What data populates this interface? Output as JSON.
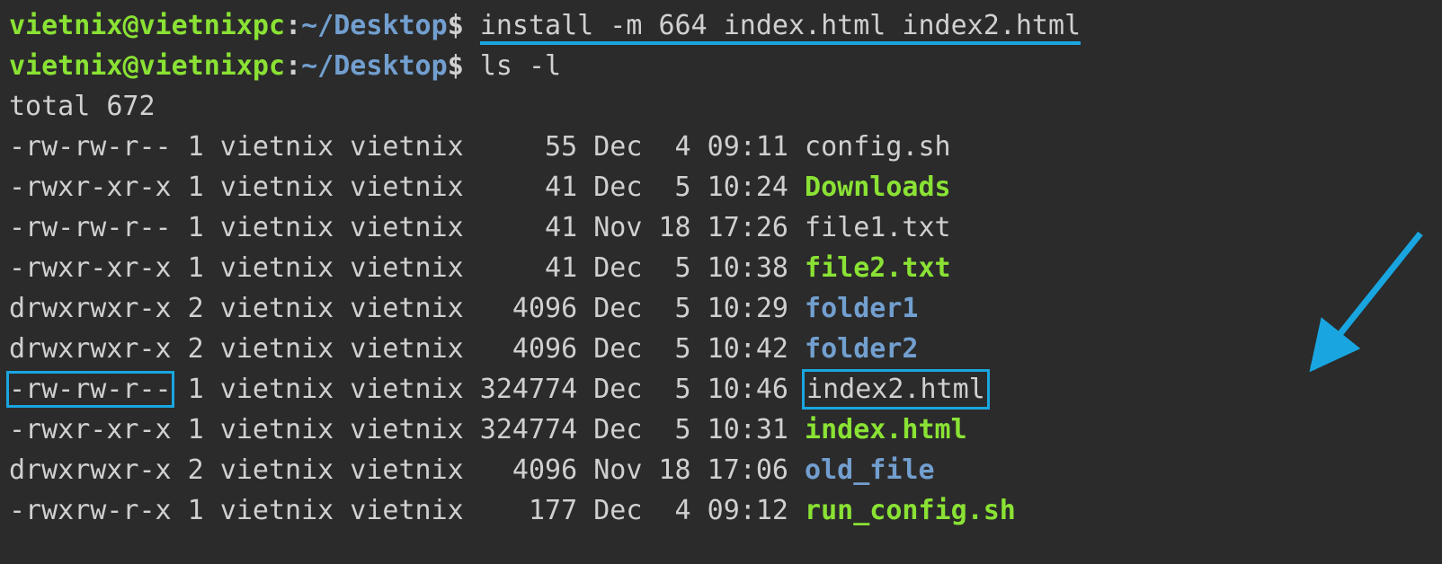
{
  "prompt": {
    "user": "vietnix",
    "host": "vietnixpc",
    "path": "~/Desktop",
    "symbol": "$"
  },
  "commands": {
    "c1": "install -m 664 index.html index2.html",
    "c2": "ls -l"
  },
  "total_line": "total 672",
  "files": [
    {
      "perm": "-rw-rw-r--",
      "links": "1",
      "owner": "vietnix",
      "group": "vietnix",
      "size": "55",
      "month": "Dec",
      "day": " 4",
      "time": "09:11",
      "name": "config.sh",
      "class": "txt"
    },
    {
      "perm": "-rwxr-xr-x",
      "links": "1",
      "owner": "vietnix",
      "group": "vietnix",
      "size": "41",
      "month": "Dec",
      "day": " 5",
      "time": "10:24",
      "name": "Downloads",
      "class": "exe"
    },
    {
      "perm": "-rw-rw-r--",
      "links": "1",
      "owner": "vietnix",
      "group": "vietnix",
      "size": "41",
      "month": "Nov",
      "day": "18",
      "time": "17:26",
      "name": "file1.txt",
      "class": "txt"
    },
    {
      "perm": "-rwxr-xr-x",
      "links": "1",
      "owner": "vietnix",
      "group": "vietnix",
      "size": "41",
      "month": "Dec",
      "day": " 5",
      "time": "10:38",
      "name": "file2.txt",
      "class": "exe"
    },
    {
      "perm": "drwxrwxr-x",
      "links": "2",
      "owner": "vietnix",
      "group": "vietnix",
      "size": "4096",
      "month": "Dec",
      "day": " 5",
      "time": "10:29",
      "name": "folder1",
      "class": "dir"
    },
    {
      "perm": "drwxrwxr-x",
      "links": "2",
      "owner": "vietnix",
      "group": "vietnix",
      "size": "4096",
      "month": "Dec",
      "day": " 5",
      "time": "10:42",
      "name": "folder2",
      "class": "dir"
    },
    {
      "perm": "-rw-rw-r--",
      "links": "1",
      "owner": "vietnix",
      "group": "vietnix",
      "size": "324774",
      "month": "Dec",
      "day": " 5",
      "time": "10:46",
      "name": "index2.html",
      "class": "txt",
      "hi_perm": true,
      "hi_name": true
    },
    {
      "perm": "-rwxr-xr-x",
      "links": "1",
      "owner": "vietnix",
      "group": "vietnix",
      "size": "324774",
      "month": "Dec",
      "day": " 5",
      "time": "10:31",
      "name": "index.html",
      "class": "exe"
    },
    {
      "perm": "drwxrwxr-x",
      "links": "2",
      "owner": "vietnix",
      "group": "vietnix",
      "size": "4096",
      "month": "Nov",
      "day": "18",
      "time": "17:06",
      "name": "old_file",
      "class": "dir"
    },
    {
      "perm": "-rwxrw-r-x",
      "links": "1",
      "owner": "vietnix",
      "group": "vietnix",
      "size": "177",
      "month": "Dec",
      "day": " 4",
      "time": "09:12",
      "name": "run_config.sh",
      "class": "exe"
    }
  ],
  "column_widths": {
    "size": 6
  }
}
